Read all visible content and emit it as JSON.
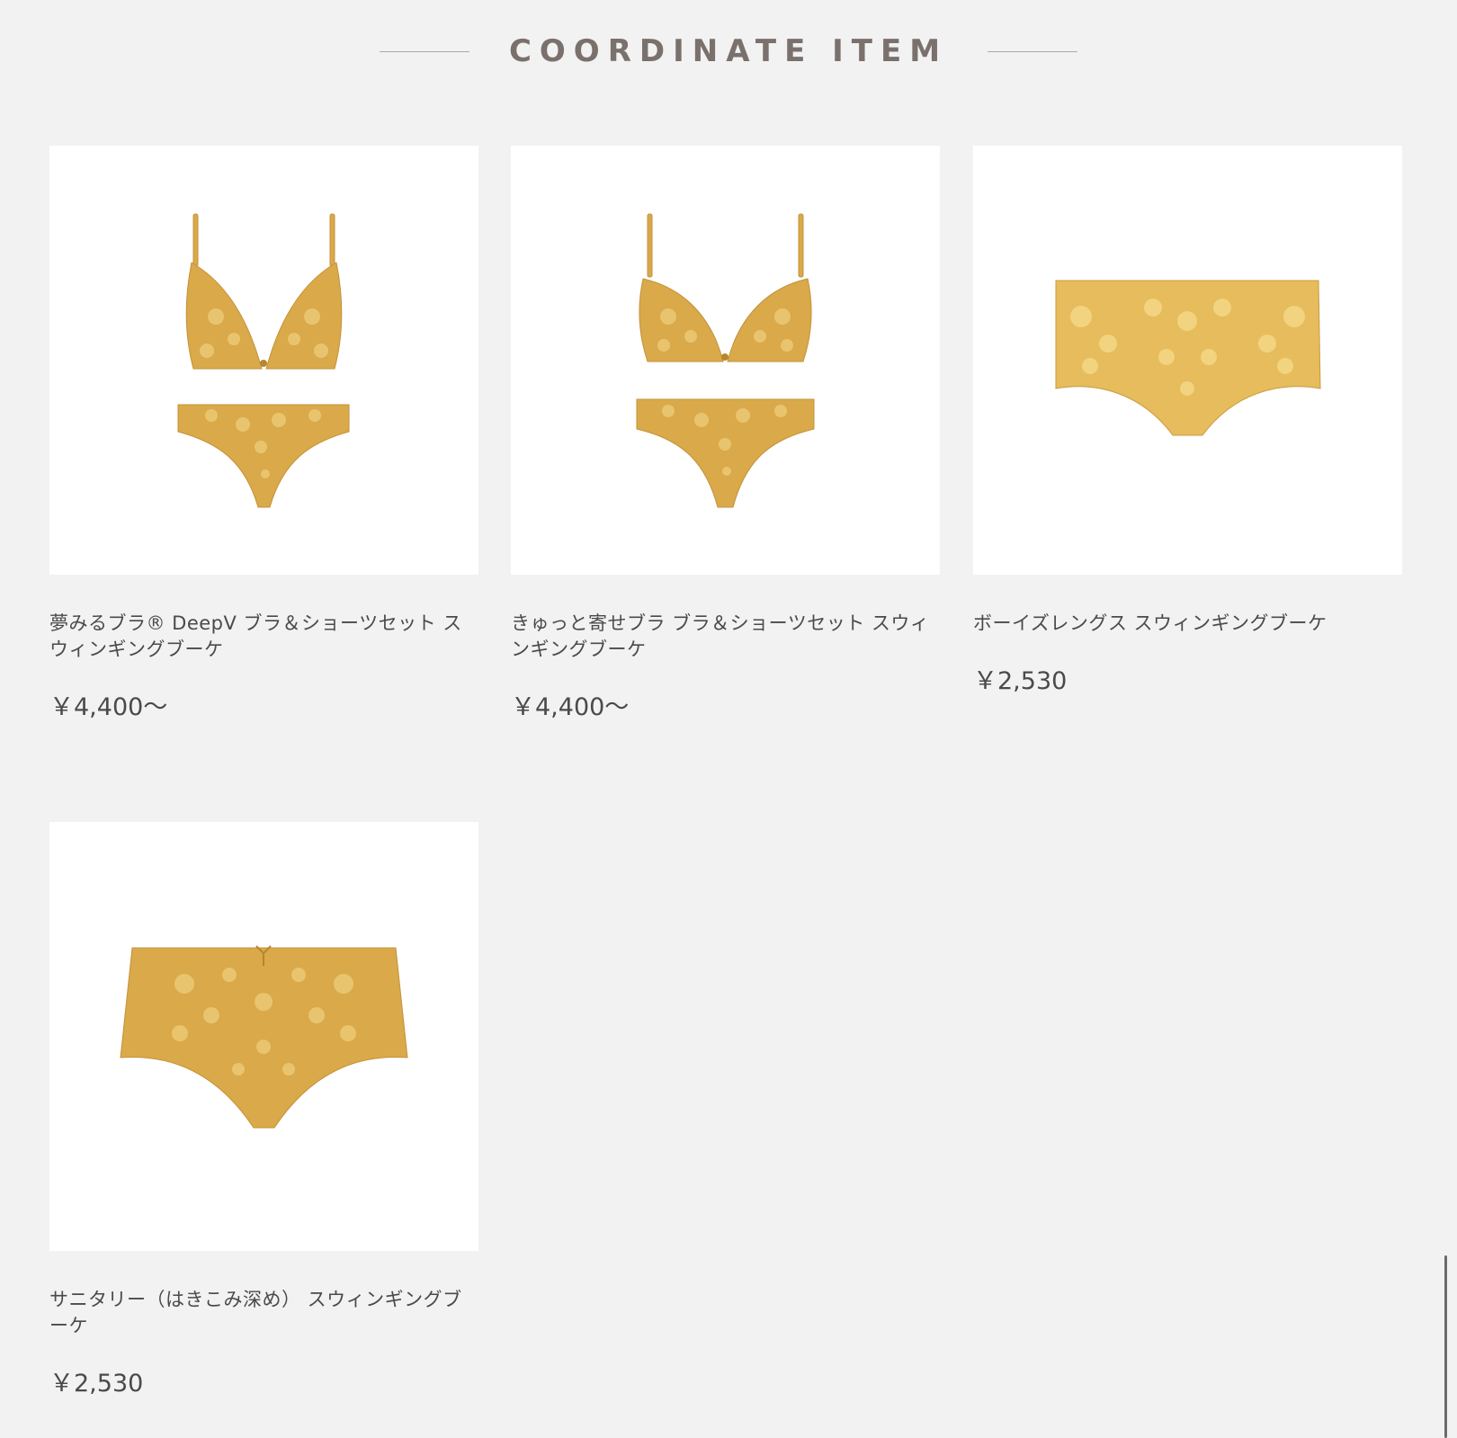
{
  "section": {
    "title": "COORDINATE ITEM"
  },
  "products": [
    {
      "name": "夢みるブラ® DeepV ブラ＆ショーツセット スウィンギングブーケ",
      "price": "￥4,400〜",
      "image_icon": "bra-and-shorts-set-image"
    },
    {
      "name": "きゅっと寄せブラ ブラ＆ショーツセット スウィンギングブーケ",
      "price": "￥4,400〜",
      "image_icon": "bra-and-shorts-set-image"
    },
    {
      "name": "ボーイズレングス スウィンギングブーケ",
      "price": "￥2,530",
      "image_icon": "boyshorts-image"
    },
    {
      "name": "サニタリー（はきこみ深め） スウィンギングブーケ",
      "price": "￥2,530",
      "image_icon": "sanitary-shorts-image"
    }
  ],
  "colors": {
    "background": "#f2f2f2",
    "product_mustard": "#d9a94a",
    "lace_light": "#efcd7a",
    "title_gray": "#7a706c"
  }
}
